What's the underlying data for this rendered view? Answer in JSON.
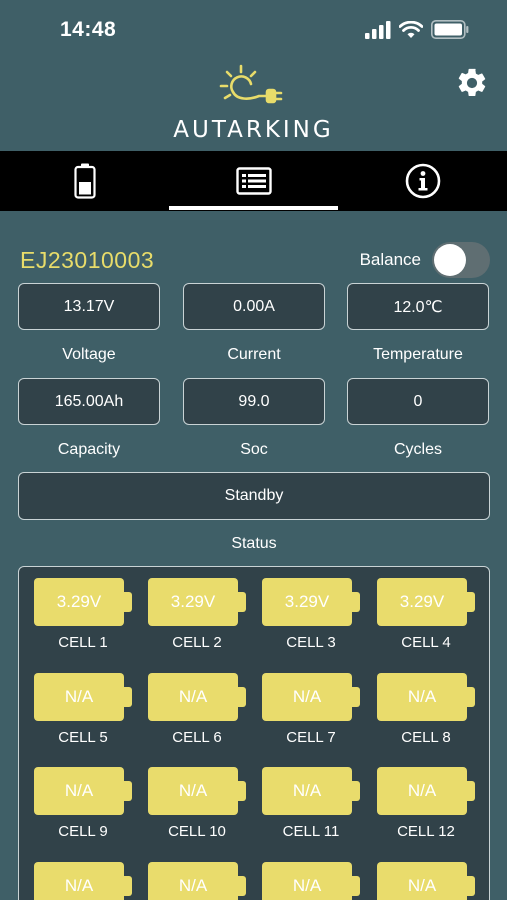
{
  "status_bar": {
    "time": "14:48"
  },
  "header": {
    "brand": "AUTARKING"
  },
  "tabs": [
    {
      "name": "battery",
      "active": false
    },
    {
      "name": "list",
      "active": true
    },
    {
      "name": "info",
      "active": false
    }
  ],
  "device": {
    "serial": "EJ23010003",
    "balance_label": "Balance",
    "balance_on": false
  },
  "metrics": {
    "voltage": {
      "value": "13.17V",
      "label": "Voltage"
    },
    "current": {
      "value": "0.00A",
      "label": "Current"
    },
    "temperature": {
      "value": "12.0℃",
      "label": "Temperature"
    },
    "capacity": {
      "value": "165.00Ah",
      "label": "Capacity"
    },
    "soc": {
      "value": "99.0",
      "label": "Soc"
    },
    "cycles": {
      "value": "0",
      "label": "Cycles"
    },
    "status": {
      "value": "Standby",
      "label": "Status"
    }
  },
  "cells": [
    {
      "name": "CELL 1",
      "value": "3.29V"
    },
    {
      "name": "CELL 2",
      "value": "3.29V"
    },
    {
      "name": "CELL 3",
      "value": "3.29V"
    },
    {
      "name": "CELL 4",
      "value": "3.29V"
    },
    {
      "name": "CELL 5",
      "value": "N/A"
    },
    {
      "name": "CELL 6",
      "value": "N/A"
    },
    {
      "name": "CELL 7",
      "value": "N/A"
    },
    {
      "name": "CELL 8",
      "value": "N/A"
    },
    {
      "name": "CELL 9",
      "value": "N/A"
    },
    {
      "name": "CELL 10",
      "value": "N/A"
    },
    {
      "name": "CELL 11",
      "value": "N/A"
    },
    {
      "name": "CELL 12",
      "value": "N/A"
    },
    {
      "name": "",
      "value": "N/A"
    },
    {
      "name": "",
      "value": "N/A"
    },
    {
      "name": "",
      "value": "N/A"
    },
    {
      "name": "",
      "value": "N/A"
    }
  ],
  "colors": {
    "background": "#3f5f67",
    "accent_yellow": "#e8dc6a",
    "cell_yellow": "#e9dc6c",
    "field_bg": "#314249",
    "tabbar": "#000000"
  }
}
